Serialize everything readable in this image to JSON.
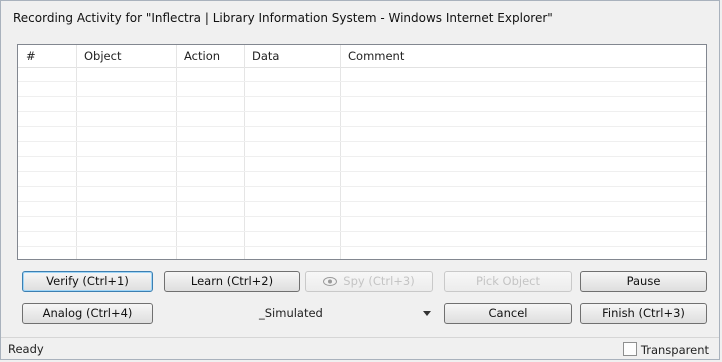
{
  "window": {
    "title": "Recording Activity for \"Inflectra | Library Information System - Windows Internet Explorer\""
  },
  "grid": {
    "columns": [
      "#",
      "Object",
      "Action",
      "Data",
      "Comment"
    ],
    "rows": []
  },
  "toolbar": {
    "verify_label": "Verify (Ctrl+1)",
    "learn_label": "Learn (Ctrl+2)",
    "spy_label": "Spy (Ctrl+3)",
    "pick_label": "Pick Object",
    "pause_label": "Pause",
    "analog_label": "Analog (Ctrl+4)",
    "mode_value": "_Simulated",
    "cancel_label": "Cancel",
    "finish_label": "Finish (Ctrl+3)"
  },
  "status": {
    "text": "Ready",
    "transparent_label": "Transparent",
    "transparent_checked": false
  },
  "icons": {
    "spy": "eye-icon",
    "dropdown": "chevron-down-icon"
  }
}
